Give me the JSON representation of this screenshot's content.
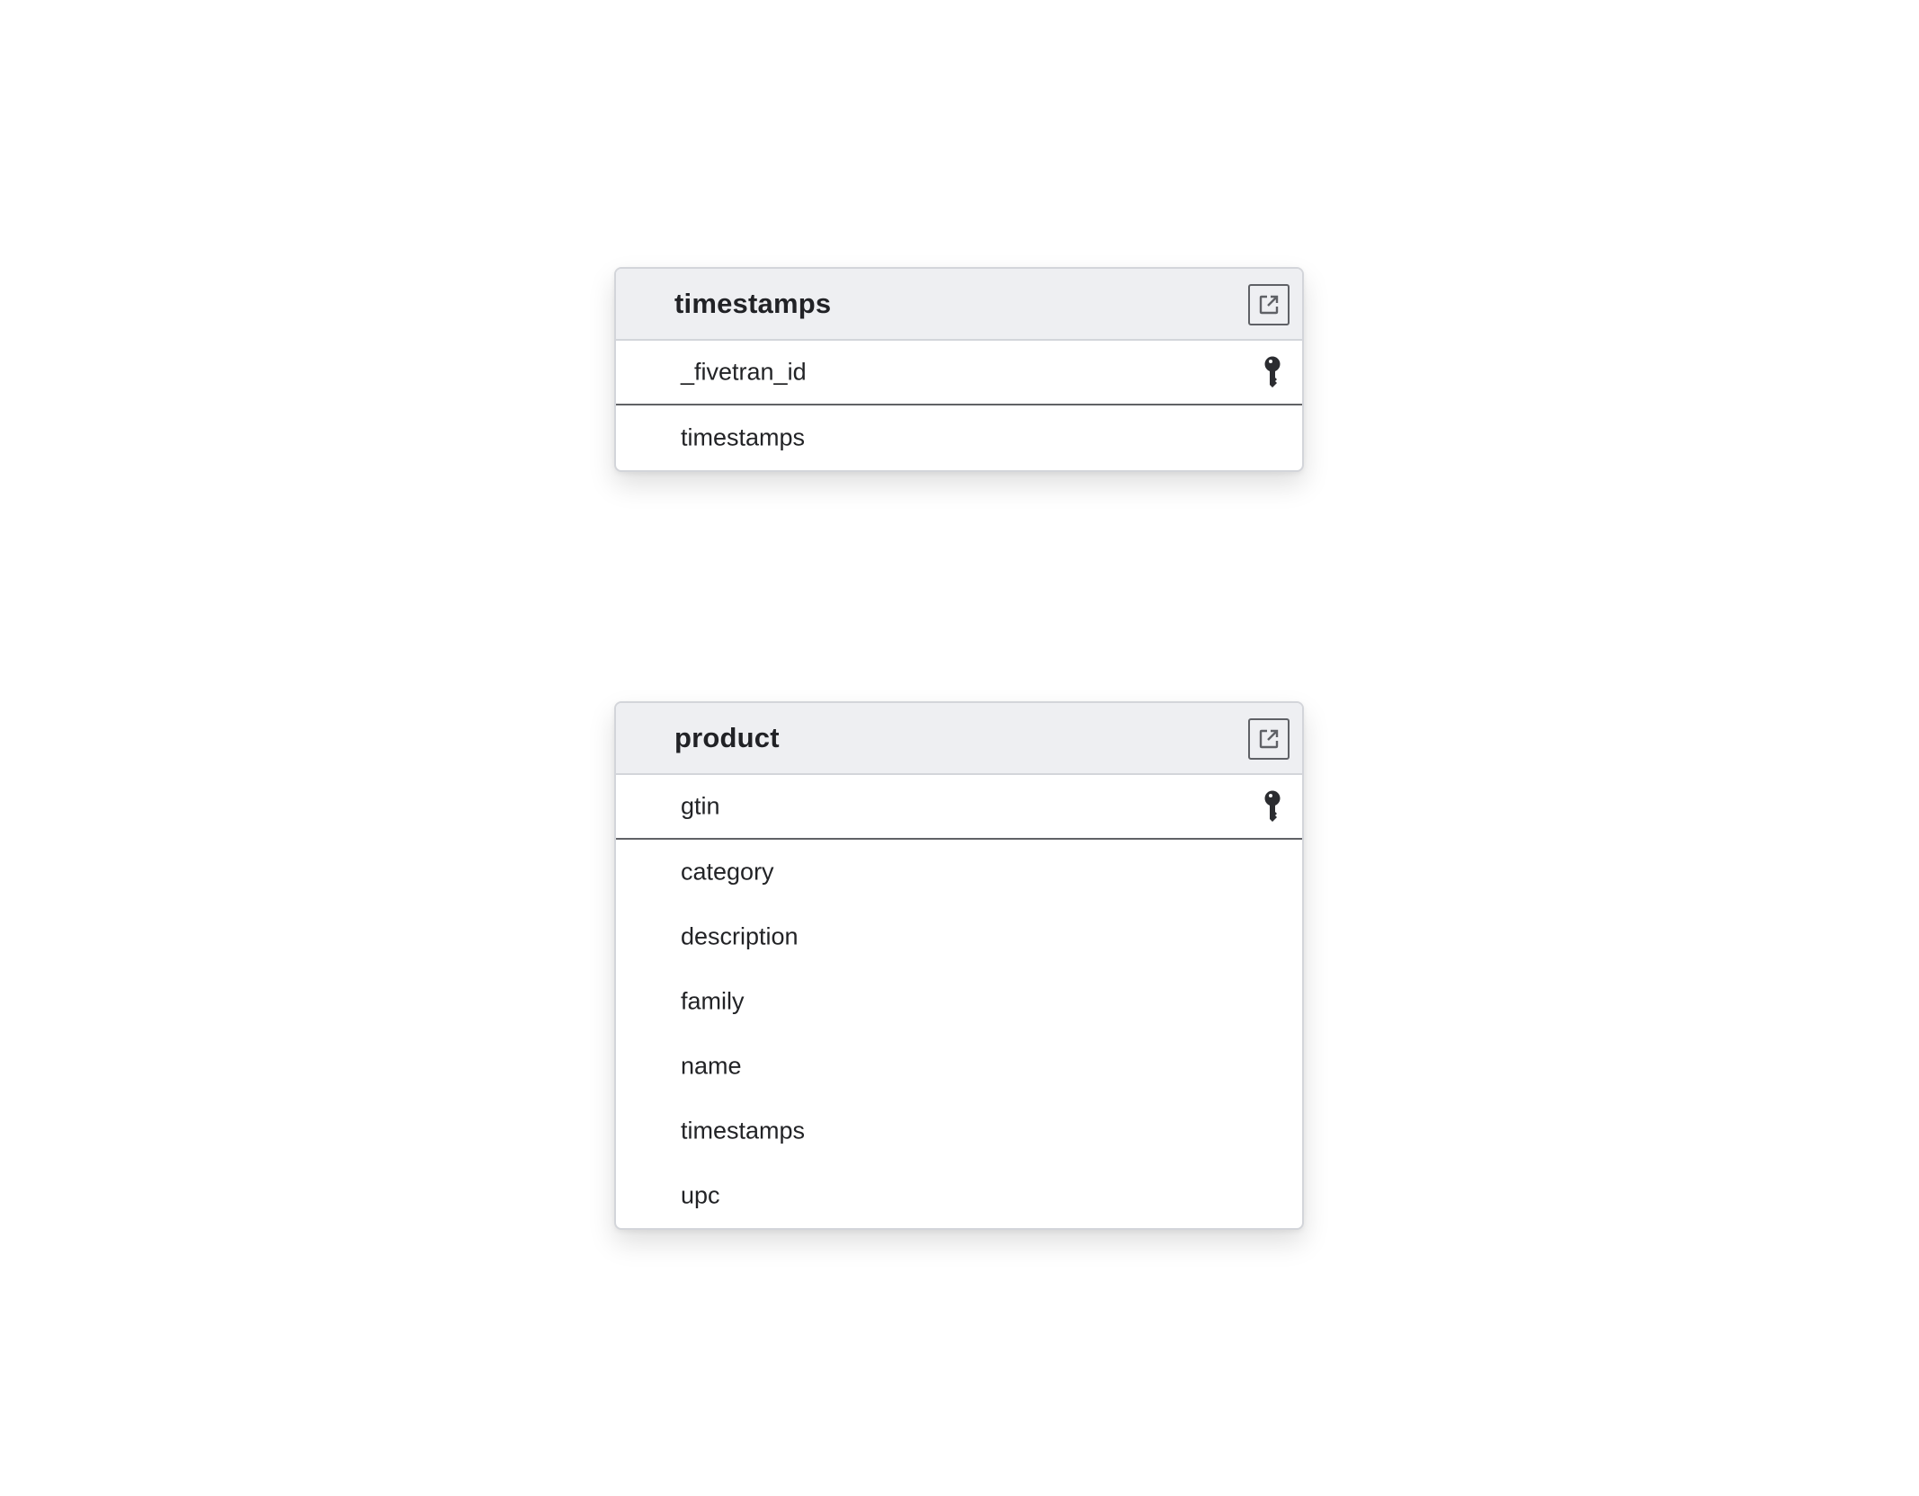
{
  "tables": [
    {
      "name": "timestamps",
      "open_icon": "external-link-icon",
      "primary_key": {
        "label": "_fivetran_id",
        "icon": "key-icon"
      },
      "columns": [
        "timestamps"
      ]
    },
    {
      "name": "product",
      "open_icon": "external-link-icon",
      "primary_key": {
        "label": "gtin",
        "icon": "key-icon"
      },
      "columns": [
        "category",
        "description",
        "family",
        "name",
        "timestamps",
        "upc"
      ]
    }
  ],
  "colors": {
    "header_bg": "#eeeff2",
    "border": "#d3d5da",
    "pk_divider": "#606266",
    "text": "#222326",
    "icon": "#2b2c30"
  }
}
